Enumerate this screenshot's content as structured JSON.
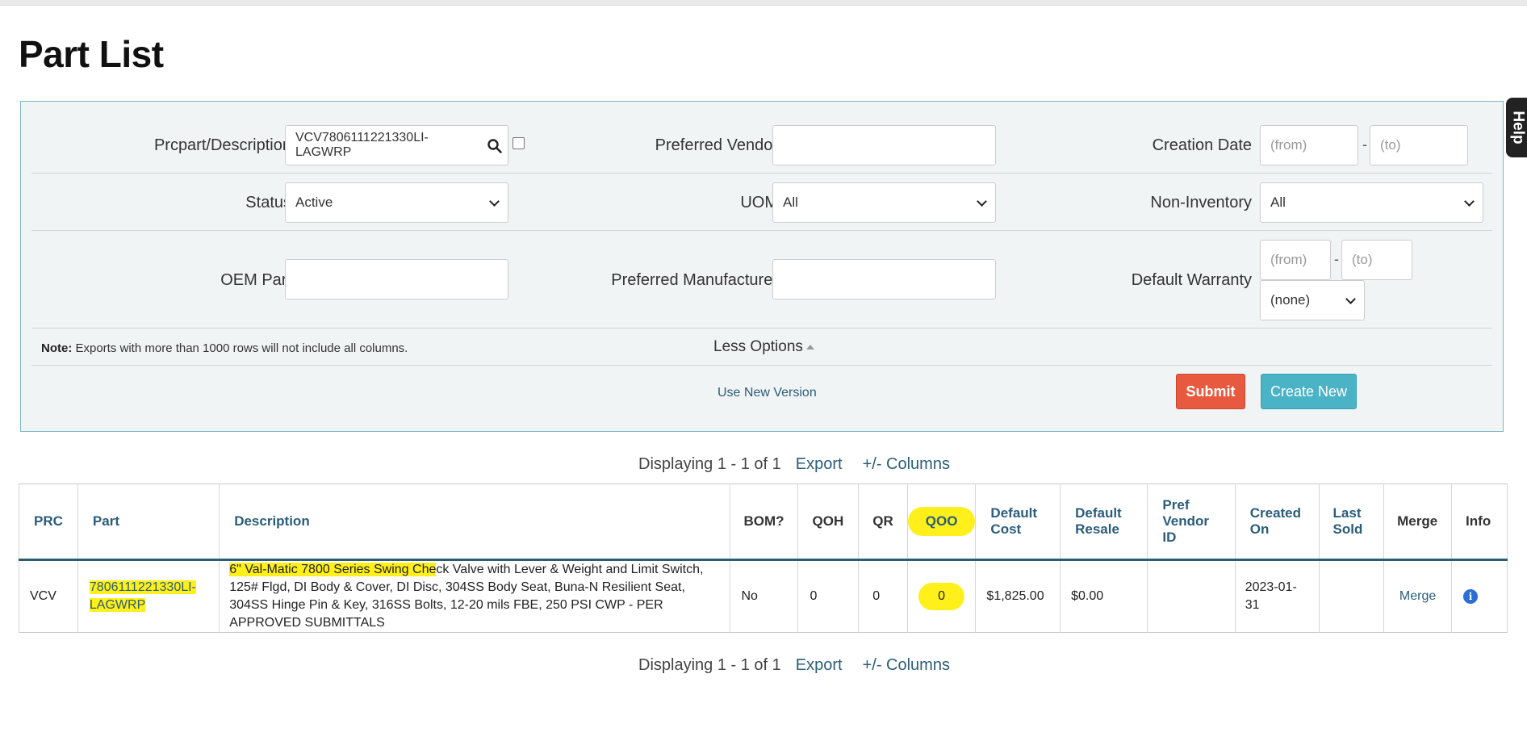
{
  "page": {
    "title": "Part List",
    "help_label": "Help"
  },
  "filters": {
    "prcpart": {
      "label": "Prcpart/Description",
      "value": "VCV7806111221330LI-LAGWRP"
    },
    "preferred_vendor": {
      "label": "Preferred Vendor",
      "value": ""
    },
    "creation_date": {
      "label": "Creation Date",
      "from_placeholder": "(from)",
      "to_placeholder": "(to)",
      "separator": "-"
    },
    "status": {
      "label": "Status",
      "selected": "Active"
    },
    "uom": {
      "label": "UOM",
      "selected": "All"
    },
    "non_inventory": {
      "label": "Non-Inventory",
      "selected": "All"
    },
    "oem_part": {
      "label": "OEM Part",
      "value": ""
    },
    "preferred_manufacturer": {
      "label": "Preferred Manufacturer",
      "value": ""
    },
    "default_warranty": {
      "label": "Default Warranty",
      "from_placeholder": "(from)",
      "to_placeholder": "(to)",
      "separator": "-",
      "selected": "(none)"
    },
    "note_label": "Note:",
    "note_text": " Exports with more than 1000 rows will not include all columns.",
    "less_options": "Less Options",
    "use_new_version": "Use New Version",
    "submit": "Submit",
    "create_new": "Create New"
  },
  "pager": {
    "text": "Displaying 1 - 1 of 1",
    "export": "Export",
    "columns": "+/- Columns"
  },
  "table": {
    "headers": {
      "prc": "PRC",
      "part": "Part",
      "description": "Description",
      "bom": "BOM?",
      "qoh": "QOH",
      "qr": "QR",
      "qoo": "QOO",
      "default_cost": "Default Cost",
      "default_resale": "Default Resale",
      "pref_vendor_id": "Pref Vendor ID",
      "created_on": "Created On",
      "last_sold": "Last Sold",
      "merge": "Merge",
      "info": "Info"
    },
    "rows": [
      {
        "prc": "VCV",
        "part": "7806111221330LI-LAGWRP",
        "description_highlight": "6\" Val-Matic 7800 Series Swing Che",
        "description_rest": "ck Valve with Lever & Weight and Limit Switch, 125# Flgd, DI Body & Cover, DI Disc, 304SS Body Seat, Buna-N Resilient Seat, 304SS Hinge Pin & Key, 316SS Bolts, 12-20 mils FBE, 250 PSI CWP - PER APPROVED SUBMITTALS",
        "bom": "No",
        "qoh": "0",
        "qr": "0",
        "qoo": "0",
        "default_cost": "$1,825.00",
        "default_resale": "$0.00",
        "pref_vendor_id": "",
        "created_on": "2023-01-31",
        "last_sold": "",
        "merge": "Merge",
        "info_icon": "info-icon"
      }
    ]
  }
}
